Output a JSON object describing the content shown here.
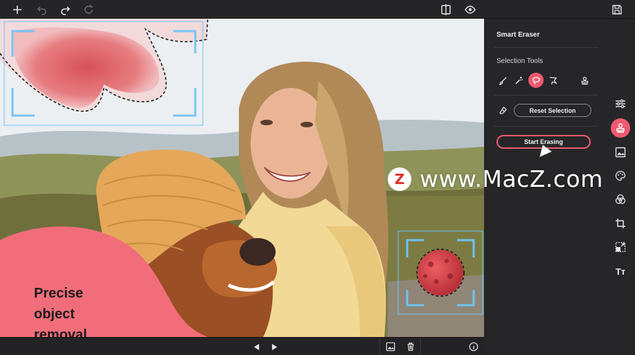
{
  "panel": {
    "title": "Smart Eraser",
    "section_label": "Selection Tools",
    "tools": [
      {
        "icon": "brush-icon"
      },
      {
        "icon": "magic-wand-icon"
      },
      {
        "icon": "lasso-icon",
        "active": true
      },
      {
        "icon": "polygon-lasso-icon"
      },
      {
        "icon": "stamp-icon"
      }
    ],
    "reset_label": "Reset Selection",
    "erase_label": "Start Erasing"
  },
  "rail": {
    "items": [
      "sliders-icon",
      "stamp-icon",
      "image-icon",
      "palette-icon",
      "blend-icon",
      "crop-icon",
      "resize-icon",
      "text-icon"
    ],
    "text_icon_glyph": "Tт"
  },
  "overlay": {
    "line1": "Precise",
    "line2": "object",
    "line3": "removal"
  },
  "watermark": {
    "logo_letter": "Z",
    "text": "www.MacZ.com"
  },
  "colors": {
    "accent": "#ee5a6f",
    "selection_box": "#6ec3f4",
    "panel_bg": "#262628",
    "blob": "#f26d7a"
  }
}
